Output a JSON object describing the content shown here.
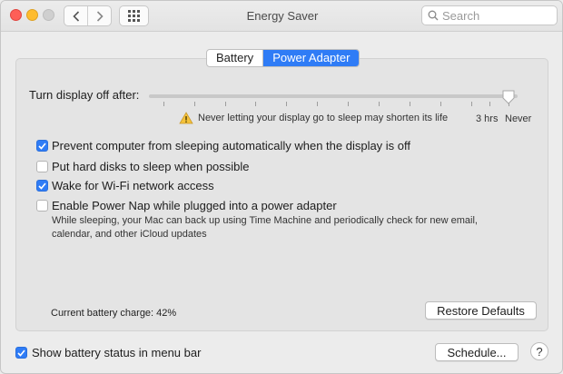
{
  "window": {
    "title": "Energy Saver"
  },
  "toolbar": {
    "back_icon": "chevron-left-icon",
    "forward_icon": "chevron-right-icon",
    "grid_icon": "show-all-grid-icon",
    "search_placeholder": "Search"
  },
  "tabs": [
    {
      "label": "Battery",
      "active": false
    },
    {
      "label": "Power Adapter",
      "active": true
    }
  ],
  "display_sleep": {
    "label": "Turn display off after:",
    "slider_value": "Never",
    "tick_labels": [
      "3 hrs",
      "Never"
    ],
    "warning": "Never letting your display go to sleep may shorten its life"
  },
  "options": [
    {
      "label": "Prevent computer from sleeping automatically when the display is off",
      "checked": true
    },
    {
      "label": "Put hard disks to sleep when possible",
      "checked": false
    },
    {
      "label": "Wake for Wi-Fi network access",
      "checked": true
    },
    {
      "label": "Enable Power Nap while plugged into a power adapter",
      "checked": false
    }
  ],
  "power_nap_description": "While sleeping, your Mac can back up using Time Machine and periodically check for new email, calendar, and other iCloud updates",
  "battery": {
    "charge_text": "Current battery charge: 42%"
  },
  "buttons": {
    "restore": "Restore Defaults",
    "schedule": "Schedule...",
    "help": "?"
  },
  "footer": {
    "show_battery_label": "Show battery status in menu bar",
    "show_battery_checked": true
  },
  "colors": {
    "accent": "#2f7cf6",
    "close": "#fe5f57",
    "minimize": "#febc2e"
  }
}
